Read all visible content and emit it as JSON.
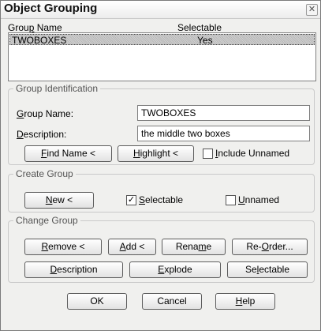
{
  "window": {
    "title": "Object Grouping",
    "close_glyph": "✕"
  },
  "list": {
    "headers": {
      "group_name_pre": "Grou",
      "group_name_u": "p",
      "group_name_post": " Name",
      "selectable": "Selectable"
    },
    "rows": [
      {
        "name": "TWOBOXES",
        "selectable": "Yes"
      }
    ]
  },
  "group_identification": {
    "legend": "Group Identification",
    "group_name_label": {
      "u": "G",
      "rest": "roup Name:"
    },
    "group_name_value": "TWOBOXES",
    "description_label": {
      "u": "D",
      "rest": "escription:"
    },
    "description_value": "the middle two boxes",
    "find_name_button": {
      "u": "F",
      "rest": "ind Name <"
    },
    "highlight_button": {
      "u": "H",
      "rest": "ighlight <"
    },
    "include_unnamed": {
      "pre": "",
      "u": "I",
      "rest": "nclude Unnamed",
      "checked": false
    }
  },
  "create_group": {
    "legend": "Create Group",
    "new_button": {
      "u": "N",
      "rest": "ew <"
    },
    "selectable": {
      "u": "S",
      "rest": "electable",
      "checked": true
    },
    "unnamed": {
      "u": "U",
      "rest": "nnamed",
      "checked": false
    }
  },
  "change_group": {
    "legend": "Change Group",
    "remove_button": {
      "u": "R",
      "rest": "emove <"
    },
    "add_button": {
      "u": "A",
      "rest": "dd <"
    },
    "rename_button": {
      "pre": "Rena",
      "u": "m",
      "rest": "e"
    },
    "reorder_button": {
      "pre": "Re-",
      "u": "O",
      "rest": "rder..."
    },
    "description_button": {
      "pre": "",
      "u": "D",
      "rest": "escription"
    },
    "explode_button": {
      "pre": "",
      "u": "E",
      "rest": "xplode"
    },
    "selectable_button": {
      "pre": "Se",
      "u": "l",
      "rest": "ectable"
    }
  },
  "footer": {
    "ok": "OK",
    "cancel": "Cancel",
    "help": {
      "u": "H",
      "rest": "elp"
    }
  },
  "icons": {
    "check_glyph": "✓"
  }
}
